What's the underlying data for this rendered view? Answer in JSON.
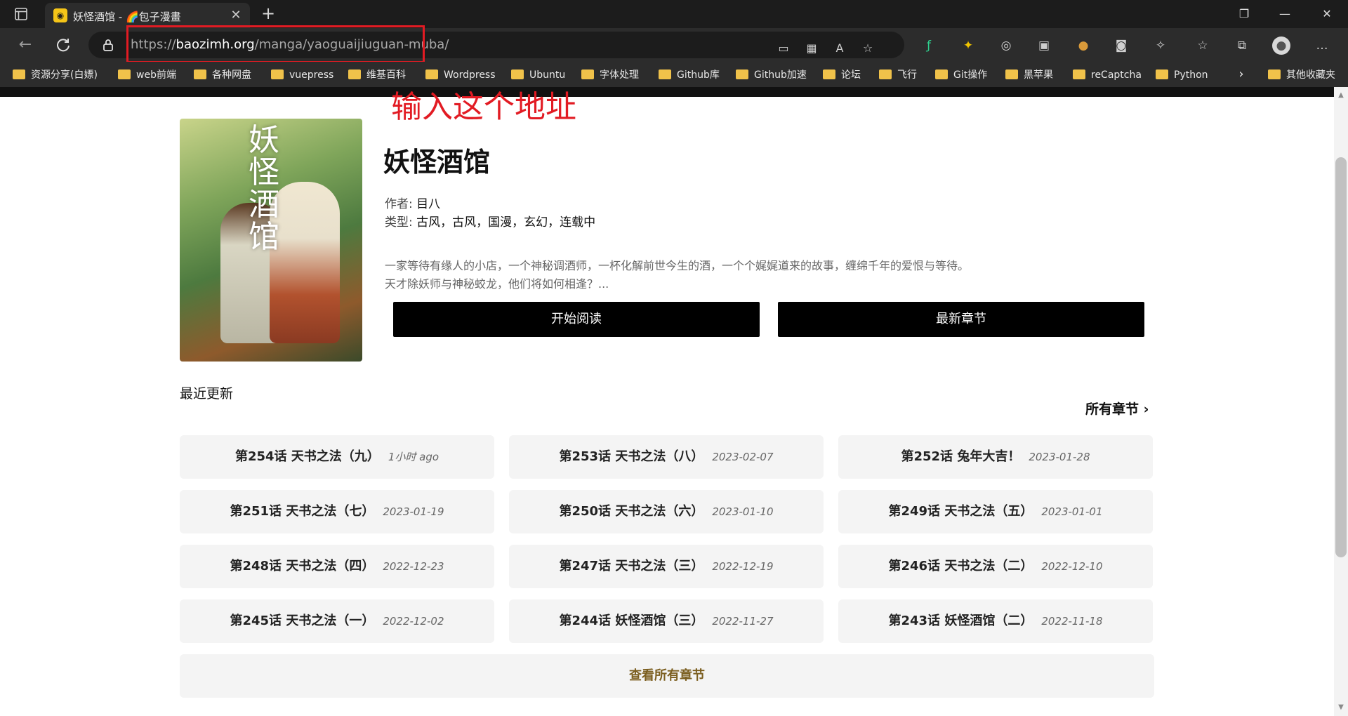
{
  "browser": {
    "tab": {
      "favicon": "baozi-favicon",
      "title": "妖怪酒馆 - 🌈包子漫畫"
    },
    "url": {
      "scheme_prefix": "https://",
      "host": "baozimh.org",
      "path": "/manga/yaoguaijiuguan-muba/"
    },
    "bookmarks": [
      "资源分享(白嫖)",
      "web前端",
      "各种网盘",
      "vuepress",
      "维基百科",
      "Wordpress",
      "Ubuntu",
      "字体处理",
      "Github库",
      "Github加速",
      "论坛",
      "飞行",
      "Git操作",
      "黑苹果",
      "reCaptcha",
      "Python"
    ],
    "bookmarks_more_label": "其他收藏夹"
  },
  "annotation": "输入这个地址",
  "manga": {
    "title": "妖怪酒馆",
    "cover_title": "妖怪酒馆",
    "author_label": "作者:",
    "author": "目八",
    "type_label": "类型:",
    "types": "古风，古风，国漫，玄幻，连载中",
    "description_line1": "一家等待有缘人的小店，一个神秘调酒师，一杯化解前世今生的酒，一个个娓娓道来的故事，缠绵千年的爱恨与等待。",
    "description_line2": "天才除妖师与神秘蛟龙，他们将如何相逢？...",
    "start_reading": "开始阅读",
    "latest_chapter": "最新章节"
  },
  "recent": {
    "section_title": "最近更新",
    "all_chapters_link": "所有章节",
    "chapters": [
      {
        "name": "第254话 天书之法（九）",
        "date": "1小时 ago"
      },
      {
        "name": "第253话 天书之法（八）",
        "date": "2023-02-07"
      },
      {
        "name": "第252话 兔年大吉！",
        "date": "2023-01-28"
      },
      {
        "name": "第251话 天书之法（七）",
        "date": "2023-01-19"
      },
      {
        "name": "第250话 天书之法（六）",
        "date": "2023-01-10"
      },
      {
        "name": "第249话 天书之法（五）",
        "date": "2023-01-01"
      },
      {
        "name": "第248话 天书之法（四）",
        "date": "2022-12-23"
      },
      {
        "name": "第247话 天书之法（三）",
        "date": "2022-12-19"
      },
      {
        "name": "第246话 天书之法（二）",
        "date": "2022-12-10"
      },
      {
        "name": "第245话 天书之法（一）",
        "date": "2022-12-02"
      },
      {
        "name": "第244话 妖怪酒馆（三）",
        "date": "2022-11-27"
      },
      {
        "name": "第243话 妖怪酒馆（二）",
        "date": "2022-11-18"
      }
    ],
    "view_all": "查看所有章节"
  },
  "colors": {
    "accent_red": "#e21b23",
    "button_bg": "#000000",
    "view_all_text": "#7b5e1f"
  }
}
